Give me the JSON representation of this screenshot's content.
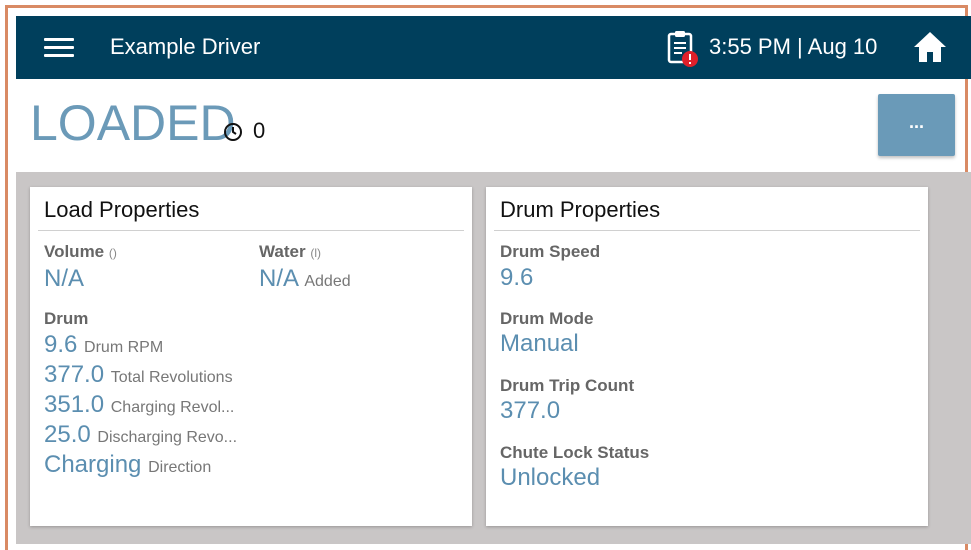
{
  "header": {
    "title": "Example Driver",
    "time": "3:55 PM | Aug 10"
  },
  "status": {
    "state": "LOADED",
    "timer_value": "0",
    "more_label": "..."
  },
  "load_properties": {
    "title": "Load Properties",
    "volume": {
      "label": "Volume",
      "unit": "()",
      "value": "N/A"
    },
    "water": {
      "label": "Water",
      "unit": "(l)",
      "value": "N/A",
      "suffix": "Added"
    },
    "drum": {
      "label": "Drum",
      "rows": [
        {
          "value": "9.6",
          "suffix": "Drum RPM"
        },
        {
          "value": "377.0",
          "suffix": "Total Revolutions"
        },
        {
          "value": "351.0",
          "suffix": "Charging Revol..."
        },
        {
          "value": "25.0",
          "suffix": "Discharging Revo..."
        },
        {
          "value": "Charging",
          "suffix": "Direction"
        }
      ]
    }
  },
  "drum_properties": {
    "title": "Drum Properties",
    "items": [
      {
        "label": "Drum Speed",
        "value": "9.6"
      },
      {
        "label": "Drum Mode",
        "value": "Manual"
      },
      {
        "label": "Drum Trip Count",
        "value": "377.0"
      },
      {
        "label": "Chute Lock Status",
        "value": "Unlocked"
      }
    ]
  },
  "colors": {
    "header_bg": "#003f5c",
    "accent": "#5b8eb0",
    "alert": "#e0202a"
  },
  "icons": [
    "menu-icon",
    "clipboard-alert-icon",
    "home-icon",
    "timer-icon"
  ]
}
